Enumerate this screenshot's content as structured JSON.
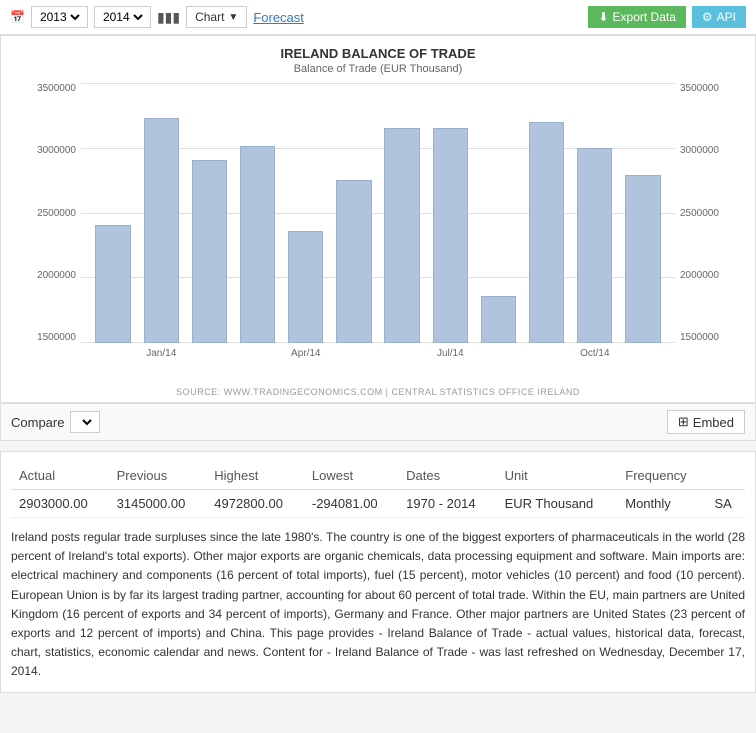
{
  "toolbar": {
    "year1": "2013",
    "year2": "2014",
    "chart_label": "Chart",
    "forecast_label": "Forecast",
    "export_label": "Export Data",
    "api_label": "API",
    "cal_icon": "📅",
    "bar_chart_icon": "📊"
  },
  "chart": {
    "title": "IRELAND BALANCE OF TRADE",
    "subtitle": "Balance of Trade (EUR Thousand)",
    "source": "SOURCE: WWW.TRADINGECONOMICS.COM | CENTRAL STATISTICS OFFICE IRELAND",
    "y_axis_labels": [
      "3500000",
      "3000000",
      "2500000",
      "2000000",
      "1500000"
    ],
    "y_axis_right": [
      "3500000",
      "3000000",
      "2500000",
      "2000000",
      "1500000"
    ],
    "bars": [
      {
        "label": "",
        "height_pct": 55,
        "value": 2500000
      },
      {
        "label": "Jan/14",
        "height_pct": 92,
        "value": 3400000
      },
      {
        "label": "",
        "height_pct": 76,
        "value": 3050000
      },
      {
        "label": "",
        "height_pct": 80,
        "value": 3170000
      },
      {
        "label": "Apr/14",
        "height_pct": 62,
        "value": 2450000
      },
      {
        "label": "",
        "height_pct": 72,
        "value": 2880000
      },
      {
        "label": "",
        "height_pct": 86,
        "value": 3320000
      },
      {
        "label": "Jul/14",
        "height_pct": 86,
        "value": 3320000
      },
      {
        "label": "",
        "height_pct": 35,
        "value": 1900000
      },
      {
        "label": "",
        "height_pct": 90,
        "value": 3370000
      },
      {
        "label": "Oct/14",
        "height_pct": 81,
        "value": 3150000
      },
      {
        "label": "",
        "height_pct": 74,
        "value": 2920000
      }
    ]
  },
  "compare": {
    "label": "Compare",
    "placeholder": "Compare"
  },
  "embed": {
    "label": "Embed",
    "icon": "⊞"
  },
  "data_row": {
    "actual": "2903000.00",
    "previous": "3145000.00",
    "highest": "4972800.00",
    "lowest": "-294081.00",
    "dates": "1970 - 2014",
    "unit": "EUR Thousand",
    "frequency": "Monthly",
    "sa": "SA"
  },
  "columns": {
    "actual": "Actual",
    "previous": "Previous",
    "highest": "Highest",
    "lowest": "Lowest",
    "dates": "Dates",
    "unit": "Unit",
    "frequency": "Frequency"
  },
  "description": "Ireland posts regular trade surpluses since the late 1980's. The country is one of the biggest exporters of pharmaceuticals in the world (28 percent of Ireland's total exports). Other major exports are organic chemicals, data processing equipment and software. Main imports are: electrical machinery and components (16 percent of total imports), fuel (15 percent), motor vehicles (10 percent) and food (10 percent). European Union is by far its largest trading partner, accounting for about 60 percent of total trade. Within the EU, main partners are United Kingdom (16 percent of exports and 34 percent of imports), Germany and France. Other major partners are United States (23 percent of exports and 12 percent of imports) and China. This page provides - Ireland Balance of Trade - actual values, historical data, forecast, chart, statistics, economic calendar and news. Content for - Ireland Balance of Trade - was last refreshed on Wednesday, December 17, 2014."
}
